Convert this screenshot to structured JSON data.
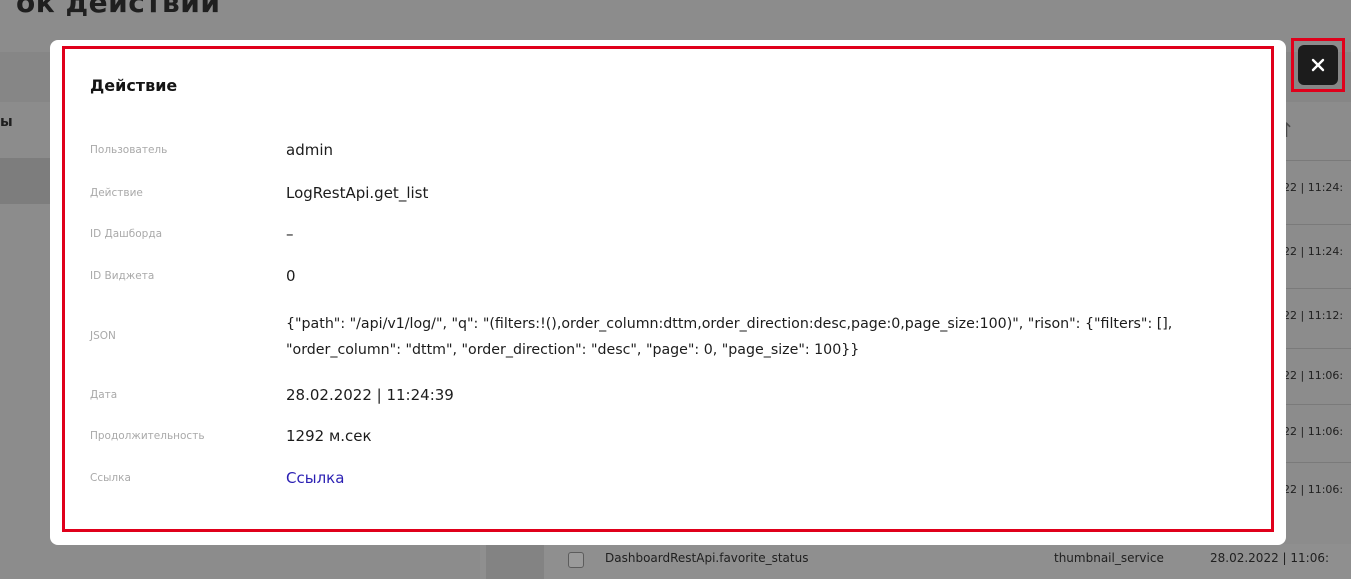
{
  "background": {
    "page_title": "ок действий",
    "sidebar_label": "ы",
    "sort_icon": "sort-arrow-up-icon",
    "row_dates": [
      "022 | 11:24:",
      "022 | 11:24:",
      "022 | 11:12:",
      "022 | 11:06:",
      "022 | 11:06:",
      "022 | 11:06:"
    ],
    "bottom_row": {
      "action": "DashboardRestApi.favorite_status",
      "user": "thumbnail_service",
      "date": "28.02.2022 | 11:06:"
    }
  },
  "modal": {
    "title": "Действие",
    "fields": [
      {
        "label": "Пользователь",
        "value": "admin"
      },
      {
        "label": "Действие",
        "value": "LogRestApi.get_list"
      },
      {
        "label": "ID Дашборда",
        "value": "–"
      },
      {
        "label": "ID Виджета",
        "value": "0"
      },
      {
        "label": "JSON",
        "value": "{\"path\": \"/api/v1/log/\", \"q\": \"(filters:!(),order_column:dttm,order_direction:desc,page:0,page_size:100)\", \"rison\": {\"filters\": [], \"order_column\": \"dttm\", \"order_direction\": \"desc\", \"page\": 0, \"page_size\": 100}}"
      },
      {
        "label": "Дата",
        "value": "28.02.2022 | 11:24:39"
      },
      {
        "label": "Продолжительность",
        "value": "1292 м.сек"
      },
      {
        "label": "Ссылка",
        "value": "Ссылка"
      }
    ]
  },
  "close_button": {
    "icon": "close-icon"
  },
  "colors": {
    "overlay": "#8c8c8c",
    "highlight": "#e0001b",
    "link": "#2a1fb3",
    "close_bg": "#1c1c1c"
  }
}
